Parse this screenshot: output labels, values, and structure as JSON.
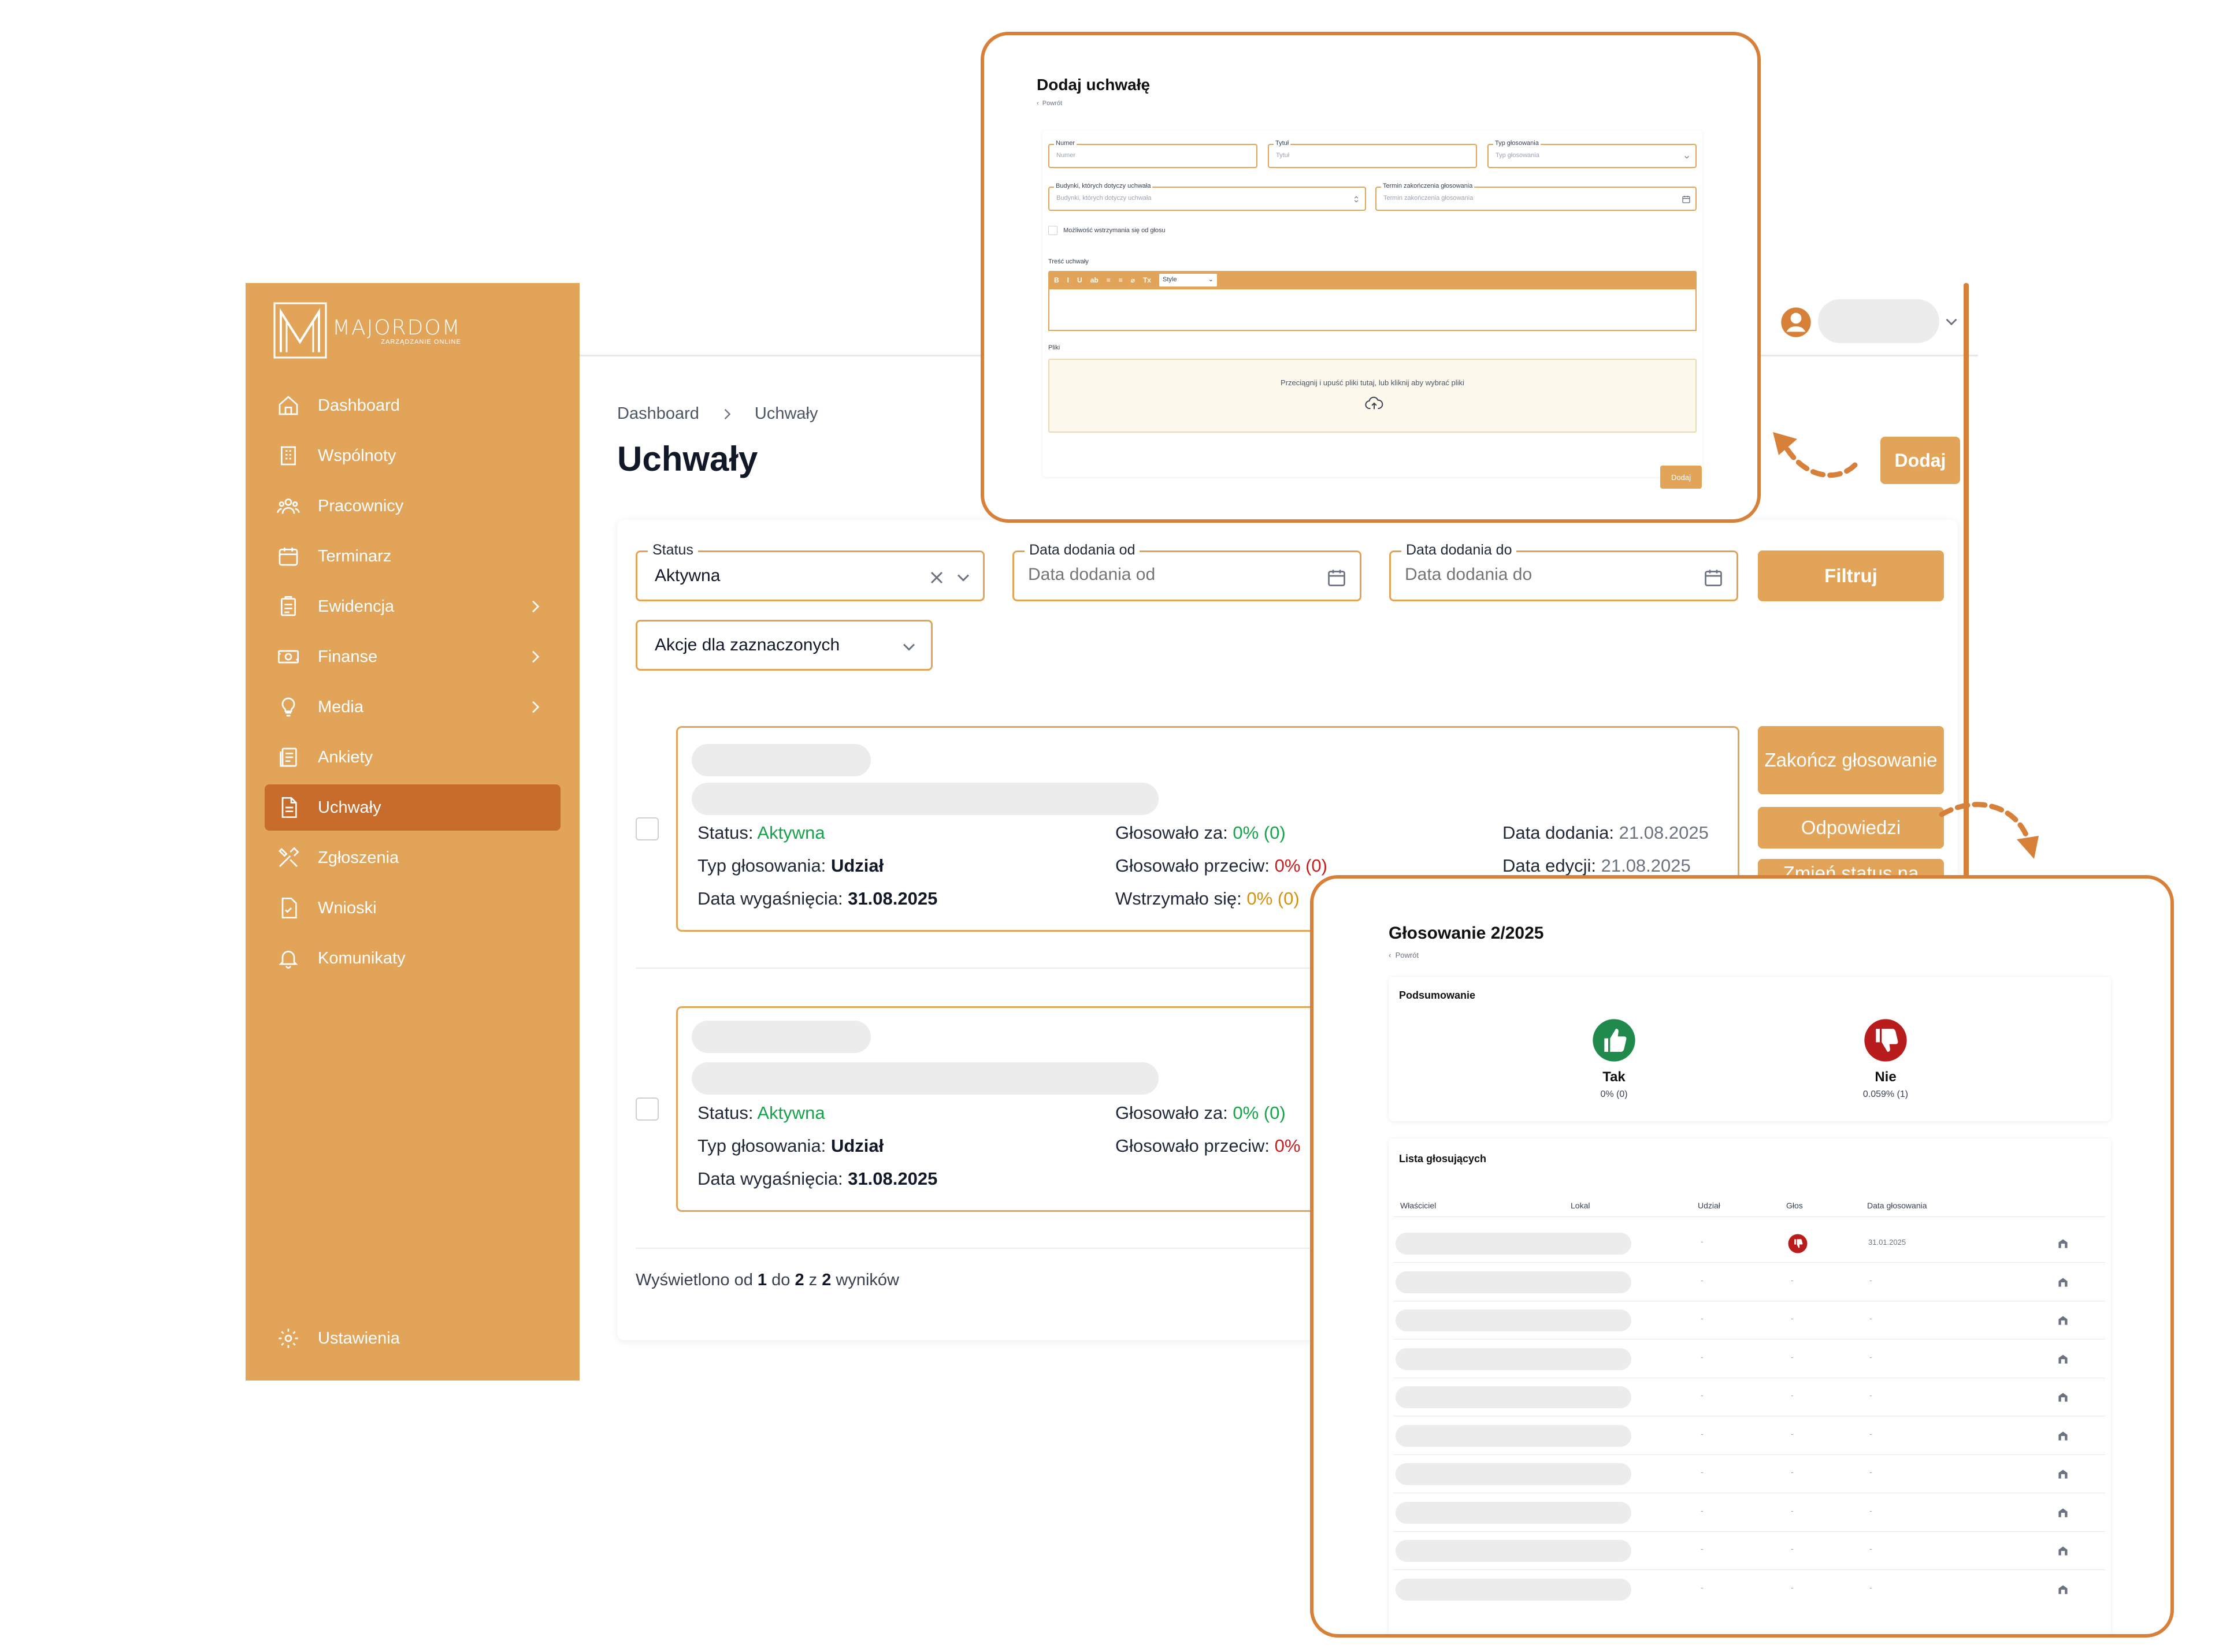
{
  "brand": {
    "name": "MAJORDOM",
    "tagline": "ZARZĄDZANIE ONLINE",
    "accent": "#e2a459",
    "active_bg": "#c86c2b",
    "frame_border": "#d6803a"
  },
  "sidebar": {
    "items": [
      {
        "label": "Dashboard",
        "icon": "home-icon"
      },
      {
        "label": "Wspólnoty",
        "icon": "building-icon"
      },
      {
        "label": "Pracownicy",
        "icon": "users-icon"
      },
      {
        "label": "Terminarz",
        "icon": "calendar-icon"
      },
      {
        "label": "Ewidencja",
        "icon": "clipboard-icon",
        "expandable": true
      },
      {
        "label": "Finanse",
        "icon": "cash-icon",
        "expandable": true
      },
      {
        "label": "Media",
        "icon": "lightbulb-icon",
        "expandable": true
      },
      {
        "label": "Ankiety",
        "icon": "survey-icon"
      },
      {
        "label": "Uchwały",
        "icon": "document-icon",
        "active": true
      },
      {
        "label": "Zgłoszenia",
        "icon": "tools-icon"
      },
      {
        "label": "Wnioski",
        "icon": "file-check-icon"
      },
      {
        "label": "Komunikaty",
        "icon": "bell-icon"
      }
    ],
    "settings": {
      "label": "Ustawienia",
      "icon": "gear-icon"
    }
  },
  "header": {
    "breadcrumb": [
      "Dashboard",
      "Uchwały"
    ],
    "title": "Uchwały",
    "add_button": "Dodaj"
  },
  "filters": {
    "status": {
      "label": "Status",
      "value": "Aktywna"
    },
    "date_from": {
      "label": "Data dodania od",
      "placeholder": "Data dodania od"
    },
    "date_to": {
      "label": "Data dodania do",
      "placeholder": "Data dodania do"
    },
    "filter_button": "Filtruj",
    "bulk_actions": "Akcje dla zaznaczonych"
  },
  "results": [
    {
      "status_label": "Status:",
      "status": "Aktywna",
      "type_label": "Typ głosowania:",
      "type": "Udział",
      "expiry_label": "Data wygaśnięcia:",
      "expiry": "31.08.2025",
      "for_label": "Głosowało za:",
      "for": "0% (0)",
      "against_label": "Głosowało przeciw:",
      "against": "0% (0)",
      "abstain_label": "Wstrzymało się:",
      "abstain": "0% (0)",
      "added_label": "Data dodania:",
      "added": "21.08.2025",
      "edited_label": "Data edycji:",
      "edited": "21.08.2025",
      "actions": [
        "Zakończ głosowanie",
        "Odpowiedzi",
        "Zmień status na"
      ]
    },
    {
      "status_label": "Status:",
      "status": "Aktywna",
      "type_label": "Typ głosowania:",
      "type": "Udział",
      "expiry_label": "Data wygaśnięcia:",
      "expiry": "31.08.2025",
      "for_label": "Głosowało za:",
      "for": "0% (0)",
      "against_label": "Głosowało przeciw:",
      "against": "0%"
    }
  ],
  "pagination": {
    "prefix": "Wyświetlono od",
    "from": "1",
    "to_word": "do",
    "to": "2",
    "of_word": "z",
    "total": "2",
    "suffix": "wyników"
  },
  "add_form": {
    "title": "Dodaj uchwałę",
    "back": "Powrót",
    "number": {
      "label": "Numer",
      "placeholder": "Numer"
    },
    "title_field": {
      "label": "Tytuł",
      "placeholder": "Tytuł"
    },
    "vote_type": {
      "label": "Typ głosowania",
      "placeholder": "Typ głosowania"
    },
    "buildings": {
      "label": "Budynki, których dotyczy uchwała",
      "placeholder": "Budynki, których dotyczy uchwała"
    },
    "deadline": {
      "label": "Termin zakończenia głosowania",
      "placeholder": "Termin zakończenia głosowania"
    },
    "abstain_checkbox": "Możliwość wstrzymania się od głosu",
    "content_label": "Treść uchwały",
    "toolbar": [
      "B",
      "I",
      "U",
      "ab",
      "≡",
      "≡",
      "⌀",
      "Tx"
    ],
    "style_select": "Style",
    "files_label": "Pliki",
    "dropzone": "Przeciągnij i upuść pliki tutaj, lub kliknij aby wybrać pliki",
    "submit": "Dodaj"
  },
  "vote_panel": {
    "title": "Głosowanie 2/2025",
    "back": "Powrót",
    "summary_label": "Podsumowanie",
    "yes": {
      "label": "Tak",
      "value": "0% (0)"
    },
    "no": {
      "label": "Nie",
      "value": "0.059% (1)"
    },
    "list_label": "Lista głosujących",
    "columns": [
      "Właściciel",
      "Lokal",
      "Udział",
      "Głos",
      "Data głosowania"
    ],
    "first_vote_date": "31.01.2025",
    "dash": "-"
  }
}
